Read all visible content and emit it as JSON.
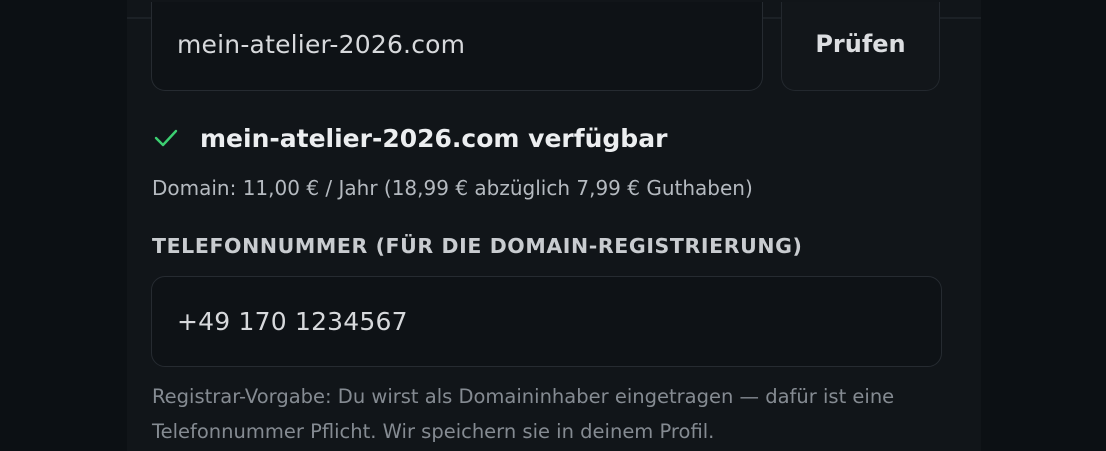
{
  "domain": {
    "input_value": "mein-atelier-2026.com",
    "check_label": "Prüfen",
    "status_icon": "check-icon",
    "available_text": "mein-atelier-2026.com verfügbar",
    "price_text": "Domain: 11,00 € / Jahr (18,99 € abzüglich 7,99 € Guthaben)"
  },
  "phone": {
    "label": "TELEFONNUMMER (FÜR DIE DOMAIN-REGISTRIERUNG)",
    "input_value": "+49 170 1234567",
    "note": "Registrar-Vorgabe: Du wirst als Domaininhaber eingetragen — dafür ist eine Telefonnummer Pflicht. Wir speichern sie in deinem Profil."
  },
  "colors": {
    "background": "#0c1014",
    "panel": "#111519",
    "success": "#3ccf71",
    "text_primary": "#eceef0",
    "text_muted": "#858b92"
  }
}
